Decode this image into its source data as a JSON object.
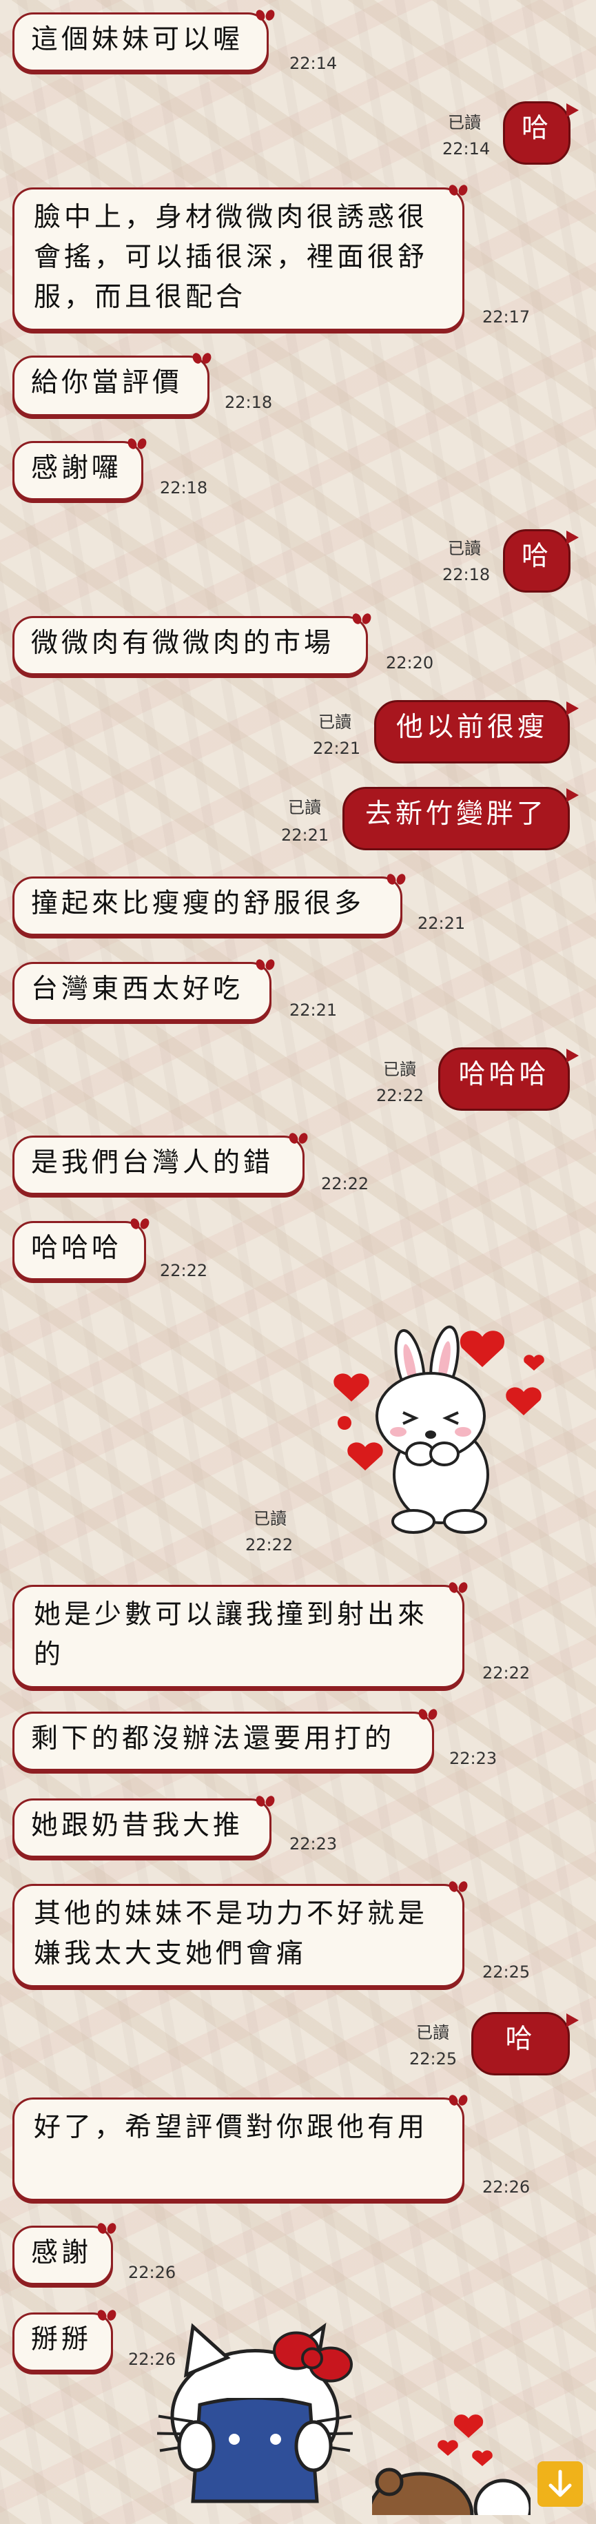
{
  "messages": [
    {
      "dir": "in",
      "text": "這個妹妹可以喔",
      "time": "22:14"
    },
    {
      "dir": "out",
      "text": "哈",
      "time": "22:14",
      "read": "已讀"
    },
    {
      "dir": "in",
      "text": "臉中上，身材微微肉很誘惑很會搖，可以插很深，裡面很舒服，而且很配合",
      "time": "22:17"
    },
    {
      "dir": "in",
      "text": "給你當評價",
      "time": "22:18"
    },
    {
      "dir": "in",
      "text": "感謝囉",
      "time": "22:18"
    },
    {
      "dir": "out",
      "text": "哈",
      "time": "22:18",
      "read": "已讀"
    },
    {
      "dir": "in",
      "text": "微微肉有微微肉的市場",
      "time": "22:20"
    },
    {
      "dir": "out",
      "text": "他以前很瘦",
      "time": "22:21",
      "read": "已讀"
    },
    {
      "dir": "out",
      "text": "去新竹變胖了",
      "time": "22:21",
      "read": "已讀"
    },
    {
      "dir": "in",
      "text": "撞起來比瘦瘦的舒服很多",
      "time": "22:21"
    },
    {
      "dir": "in",
      "text": "台灣東西太好吃",
      "time": "22:21"
    },
    {
      "dir": "out",
      "text": "哈哈哈",
      "time": "22:22",
      "read": "已讀"
    },
    {
      "dir": "in",
      "text": "是我們台灣人的錯",
      "time": "22:22"
    },
    {
      "dir": "in",
      "text": "哈哈哈",
      "time": "22:22"
    },
    {
      "dir": "out",
      "text": "",
      "time": "22:22",
      "read": "已讀",
      "sticker": "rabbit-hearts-sticker"
    },
    {
      "dir": "in",
      "text": "她是少數可以讓我撞到射出來的",
      "time": "22:22"
    },
    {
      "dir": "in",
      "text": "剩下的都沒辦法還要用打的",
      "time": "22:23"
    },
    {
      "dir": "in",
      "text": "她跟奶昔我大推",
      "time": "22:23"
    },
    {
      "dir": "in",
      "text": "其他的妹妹不是功力不好就是嫌我太大支她們會痛",
      "time": "22:25"
    },
    {
      "dir": "out",
      "text": "哈",
      "time": "22:25",
      "read": "已讀"
    },
    {
      "dir": "in",
      "text": "好了，希望評價對你跟他有用",
      "time": "22:26"
    },
    {
      "dir": "in",
      "text": "感謝",
      "time": "22:26"
    },
    {
      "dir": "in",
      "text": "掰掰",
      "time": "22:26"
    },
    {
      "dir": "in",
      "text": "",
      "time": "",
      "sticker": "kitty-sticker"
    }
  ],
  "icons": {
    "scroll_down": "arrow-down-icon",
    "bubble_bow": "bow-icon"
  },
  "colors": {
    "accent": "#a8161e",
    "bubble_in": "#fbf7ef",
    "scroll_button": "#f0b21a"
  }
}
